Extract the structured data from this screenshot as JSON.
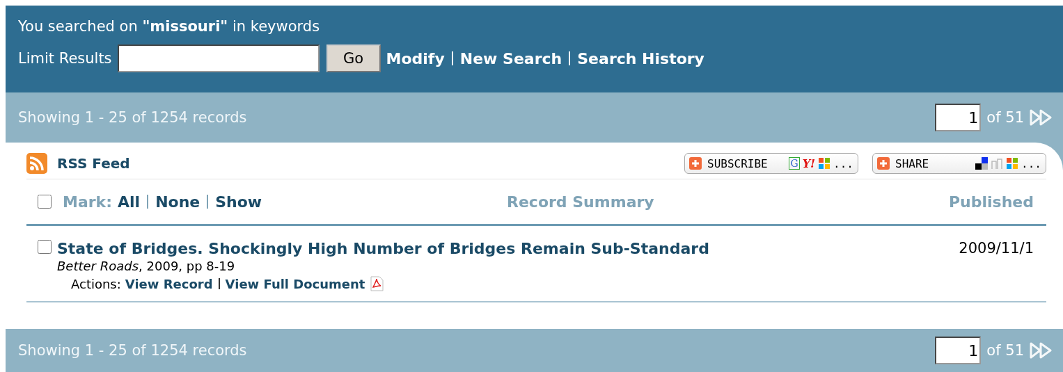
{
  "search_summary": {
    "prefix": "You searched on",
    "term": "\"missouri\"",
    "suffix": "in keywords"
  },
  "limit": {
    "label": "Limit Results",
    "button": "Go",
    "links": [
      "Modify",
      "New Search",
      "Search History"
    ]
  },
  "pager_top": {
    "showing": "Showing 1 - 25 of 1254 records",
    "page": "1",
    "of": "of 51"
  },
  "feed": {
    "label": "RSS Feed"
  },
  "widgets": [
    {
      "label": "SUBSCRIBE",
      "services": [
        "G",
        "Y!"
      ],
      "more": "..."
    },
    {
      "label": "SHARE",
      "more": "..."
    }
  ],
  "mark": {
    "label": "Mark:",
    "checked": false,
    "links": [
      "All",
      "None",
      "Show"
    ]
  },
  "columns": [
    "Record Summary",
    "Published"
  ],
  "records": [
    {
      "checked": false,
      "title": "State of Bridges. Shockingly High Number of Bridges Remain Sub-Standard",
      "source": "Better Roads",
      "citation": ", 2009, pp 8-19",
      "actions_label": "Actions:",
      "actions": [
        "View Record",
        "View Full Document"
      ],
      "pdf": true,
      "published": "2009/11/1"
    }
  ],
  "pager_bottom": {
    "showing": "Showing 1 - 25 of 1254 records",
    "page": "1",
    "of": "of 51"
  }
}
